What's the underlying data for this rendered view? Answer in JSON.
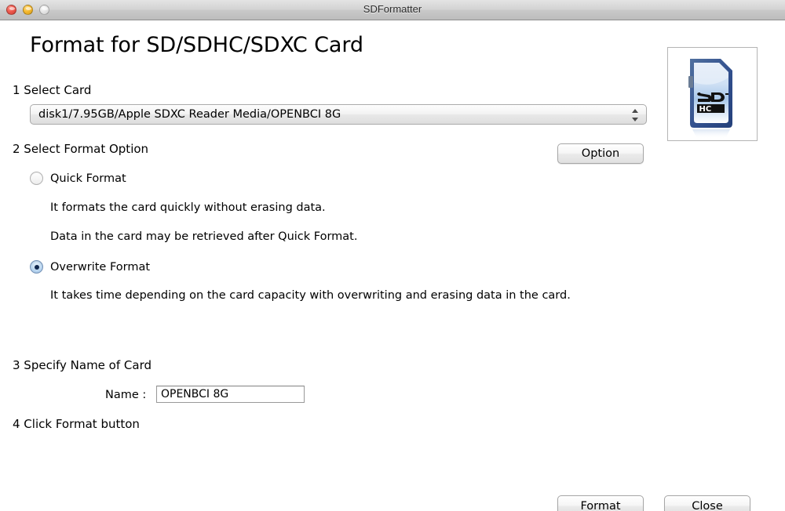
{
  "window": {
    "title": "SDFormatter",
    "traffic_lights": [
      {
        "name": "close",
        "color": "#f05b50"
      },
      {
        "name": "minimize",
        "color": "#f7bb32"
      },
      {
        "name": "zoom",
        "color": "#e6e6e6"
      }
    ]
  },
  "heading": "Format for SD/SDHC/SDXC Card",
  "card_image": {
    "alt": "SDHC memory card",
    "logo_top": "SD",
    "logo_bottom": "HC"
  },
  "step1": {
    "label": "1 Select Card",
    "selected_card": "disk1/7.95GB/Apple SDXC Reader Media/OPENBCI 8G"
  },
  "step2": {
    "label": "2 Select Format Option",
    "option_button": "Option",
    "options": [
      {
        "id": "quick-format",
        "label": "Quick Format",
        "selected": false,
        "descriptions": [
          "It formats the card quickly without erasing data.",
          "Data in the card may be retrieved after Quick Format."
        ]
      },
      {
        "id": "overwrite-format",
        "label": "Overwrite Format",
        "selected": true,
        "descriptions": [
          "It takes time depending on the card capacity with overwriting and erasing data in the card."
        ]
      }
    ]
  },
  "step3": {
    "label": "3 Specify Name of Card",
    "name_label": "Name :",
    "name_value": "OPENBCI 8G"
  },
  "step4": {
    "label": "4 Click Format button"
  },
  "footer": {
    "format_button": "Format",
    "close_button": "Close"
  },
  "colors": {
    "accent_radio": "#10264d",
    "card_blue": "#3a5ba0",
    "window_chrome": "#d3d3d3"
  }
}
